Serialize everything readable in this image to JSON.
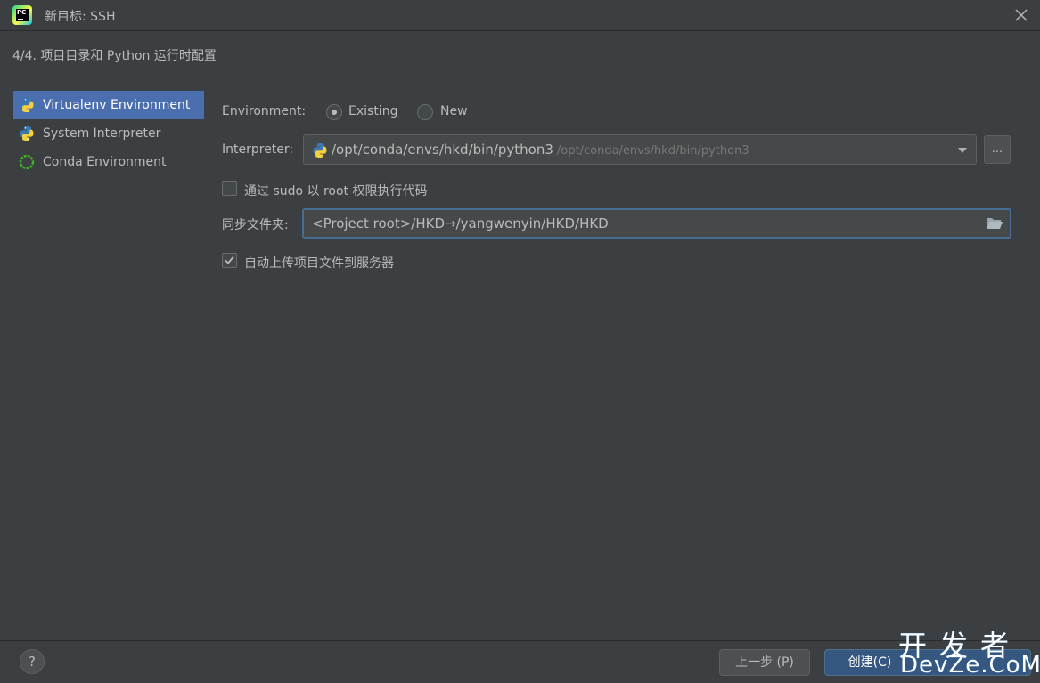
{
  "window": {
    "title": "新目标: SSH",
    "app_icon_text": "PC"
  },
  "step": {
    "text": "4/4. 项目目录和 Python 运行时配置"
  },
  "sidebar": {
    "items": [
      {
        "label": "Virtualenv Environment",
        "icon": "python-virtualenv-icon",
        "selected": true
      },
      {
        "label": "System Interpreter",
        "icon": "python-icon",
        "selected": false
      },
      {
        "label": "Conda Environment",
        "icon": "conda-icon",
        "selected": false
      }
    ]
  },
  "form": {
    "environment_label": "Environment:",
    "environment_options": [
      {
        "label": "Existing",
        "checked": true
      },
      {
        "label": "New",
        "checked": false
      }
    ],
    "interpreter_label": "Interpreter:",
    "interpreter_value": "/opt/conda/envs/hkd/bin/python3",
    "interpreter_hint": "/opt/conda/envs/hkd/bin/python3",
    "browse_label": "...",
    "sudo_checkbox_label": "通过 sudo 以 root 权限执行代码",
    "sudo_checked": false,
    "sync_folder_label": "同步文件夹:",
    "sync_folder_value": "<Project root>/HKD→/yangwenyin/HKD/HKD",
    "auto_upload_label": "自动上传项目文件到服务器",
    "auto_upload_checked": true
  },
  "footer": {
    "help_label": "?",
    "prev_label": "上一步 (P)",
    "create_label": "创建(C)"
  },
  "watermark": {
    "cn": "开发者",
    "en": "DevZe.CoM"
  },
  "colors": {
    "background": "#3c3f41",
    "selection": "#4b6eaf",
    "primary_button": "#365880",
    "focus_border": "#466d94"
  }
}
